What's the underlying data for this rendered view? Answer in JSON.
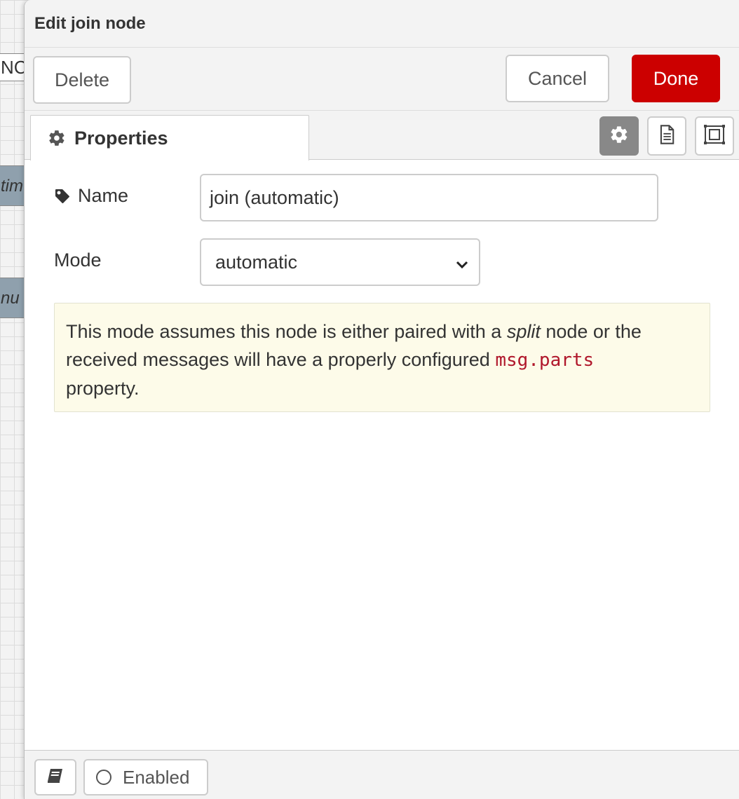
{
  "canvas": {
    "nodes": [
      {
        "label": "NC"
      },
      {
        "label": "tim"
      },
      {
        "label": "nu"
      }
    ]
  },
  "dialog": {
    "title": "Edit join node",
    "delete_label": "Delete",
    "cancel_label": "Cancel",
    "done_label": "Done",
    "done_color": "#cc0000",
    "tabs": [
      {
        "label": "Properties",
        "icon": "gear-icon"
      }
    ],
    "side_icons": [
      "gear-icon",
      "document-icon",
      "frame-icon"
    ]
  },
  "form": {
    "name_label": "Name",
    "name_value": "join (automatic)",
    "mode_label": "Mode",
    "mode_value": "automatic",
    "tip": {
      "part1": "This mode assumes this node is either paired with a ",
      "emphasis": "split",
      "part2": " node or the received messages will have a properly configured ",
      "code": "msg.parts",
      "part3": " property."
    }
  },
  "footer": {
    "enabled_label": "Enabled",
    "book_icon": "book-icon"
  }
}
